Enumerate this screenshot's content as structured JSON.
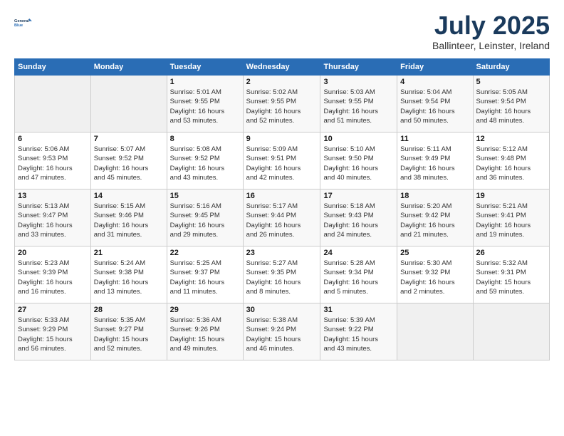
{
  "header": {
    "logo_line1": "General",
    "logo_line2": "Blue",
    "month": "July 2025",
    "location": "Ballinteer, Leinster, Ireland"
  },
  "weekdays": [
    "Sunday",
    "Monday",
    "Tuesday",
    "Wednesday",
    "Thursday",
    "Friday",
    "Saturday"
  ],
  "weeks": [
    [
      {
        "day": "",
        "info": ""
      },
      {
        "day": "",
        "info": ""
      },
      {
        "day": "1",
        "info": "Sunrise: 5:01 AM\nSunset: 9:55 PM\nDaylight: 16 hours\nand 53 minutes."
      },
      {
        "day": "2",
        "info": "Sunrise: 5:02 AM\nSunset: 9:55 PM\nDaylight: 16 hours\nand 52 minutes."
      },
      {
        "day": "3",
        "info": "Sunrise: 5:03 AM\nSunset: 9:55 PM\nDaylight: 16 hours\nand 51 minutes."
      },
      {
        "day": "4",
        "info": "Sunrise: 5:04 AM\nSunset: 9:54 PM\nDaylight: 16 hours\nand 50 minutes."
      },
      {
        "day": "5",
        "info": "Sunrise: 5:05 AM\nSunset: 9:54 PM\nDaylight: 16 hours\nand 48 minutes."
      }
    ],
    [
      {
        "day": "6",
        "info": "Sunrise: 5:06 AM\nSunset: 9:53 PM\nDaylight: 16 hours\nand 47 minutes."
      },
      {
        "day": "7",
        "info": "Sunrise: 5:07 AM\nSunset: 9:52 PM\nDaylight: 16 hours\nand 45 minutes."
      },
      {
        "day": "8",
        "info": "Sunrise: 5:08 AM\nSunset: 9:52 PM\nDaylight: 16 hours\nand 43 minutes."
      },
      {
        "day": "9",
        "info": "Sunrise: 5:09 AM\nSunset: 9:51 PM\nDaylight: 16 hours\nand 42 minutes."
      },
      {
        "day": "10",
        "info": "Sunrise: 5:10 AM\nSunset: 9:50 PM\nDaylight: 16 hours\nand 40 minutes."
      },
      {
        "day": "11",
        "info": "Sunrise: 5:11 AM\nSunset: 9:49 PM\nDaylight: 16 hours\nand 38 minutes."
      },
      {
        "day": "12",
        "info": "Sunrise: 5:12 AM\nSunset: 9:48 PM\nDaylight: 16 hours\nand 36 minutes."
      }
    ],
    [
      {
        "day": "13",
        "info": "Sunrise: 5:13 AM\nSunset: 9:47 PM\nDaylight: 16 hours\nand 33 minutes."
      },
      {
        "day": "14",
        "info": "Sunrise: 5:15 AM\nSunset: 9:46 PM\nDaylight: 16 hours\nand 31 minutes."
      },
      {
        "day": "15",
        "info": "Sunrise: 5:16 AM\nSunset: 9:45 PM\nDaylight: 16 hours\nand 29 minutes."
      },
      {
        "day": "16",
        "info": "Sunrise: 5:17 AM\nSunset: 9:44 PM\nDaylight: 16 hours\nand 26 minutes."
      },
      {
        "day": "17",
        "info": "Sunrise: 5:18 AM\nSunset: 9:43 PM\nDaylight: 16 hours\nand 24 minutes."
      },
      {
        "day": "18",
        "info": "Sunrise: 5:20 AM\nSunset: 9:42 PM\nDaylight: 16 hours\nand 21 minutes."
      },
      {
        "day": "19",
        "info": "Sunrise: 5:21 AM\nSunset: 9:41 PM\nDaylight: 16 hours\nand 19 minutes."
      }
    ],
    [
      {
        "day": "20",
        "info": "Sunrise: 5:23 AM\nSunset: 9:39 PM\nDaylight: 16 hours\nand 16 minutes."
      },
      {
        "day": "21",
        "info": "Sunrise: 5:24 AM\nSunset: 9:38 PM\nDaylight: 16 hours\nand 13 minutes."
      },
      {
        "day": "22",
        "info": "Sunrise: 5:25 AM\nSunset: 9:37 PM\nDaylight: 16 hours\nand 11 minutes."
      },
      {
        "day": "23",
        "info": "Sunrise: 5:27 AM\nSunset: 9:35 PM\nDaylight: 16 hours\nand 8 minutes."
      },
      {
        "day": "24",
        "info": "Sunrise: 5:28 AM\nSunset: 9:34 PM\nDaylight: 16 hours\nand 5 minutes."
      },
      {
        "day": "25",
        "info": "Sunrise: 5:30 AM\nSunset: 9:32 PM\nDaylight: 16 hours\nand 2 minutes."
      },
      {
        "day": "26",
        "info": "Sunrise: 5:32 AM\nSunset: 9:31 PM\nDaylight: 15 hours\nand 59 minutes."
      }
    ],
    [
      {
        "day": "27",
        "info": "Sunrise: 5:33 AM\nSunset: 9:29 PM\nDaylight: 15 hours\nand 56 minutes."
      },
      {
        "day": "28",
        "info": "Sunrise: 5:35 AM\nSunset: 9:27 PM\nDaylight: 15 hours\nand 52 minutes."
      },
      {
        "day": "29",
        "info": "Sunrise: 5:36 AM\nSunset: 9:26 PM\nDaylight: 15 hours\nand 49 minutes."
      },
      {
        "day": "30",
        "info": "Sunrise: 5:38 AM\nSunset: 9:24 PM\nDaylight: 15 hours\nand 46 minutes."
      },
      {
        "day": "31",
        "info": "Sunrise: 5:39 AM\nSunset: 9:22 PM\nDaylight: 15 hours\nand 43 minutes."
      },
      {
        "day": "",
        "info": ""
      },
      {
        "day": "",
        "info": ""
      }
    ]
  ]
}
